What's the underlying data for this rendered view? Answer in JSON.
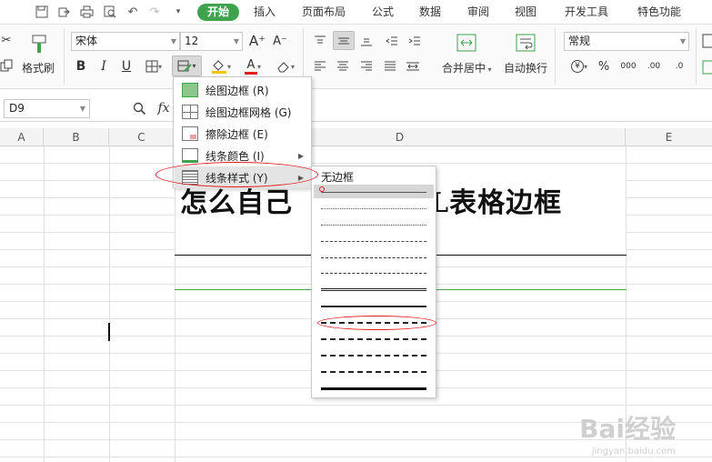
{
  "tabs": [
    "开始",
    "插入",
    "页面布局",
    "公式",
    "数据",
    "审阅",
    "视图",
    "开发工具",
    "特色功能"
  ],
  "ribbon": {
    "format_painter": "格式刷",
    "font_name": "宋体",
    "font_size": "12",
    "merge_center": "合并居中",
    "wrap_text": "自动换行",
    "number_format": "常规",
    "bold": "B",
    "italic": "I",
    "underline": "U",
    "grow_font": "A⁺",
    "shrink_font": "A⁻",
    "font_color_letter": "A",
    "percent": "%",
    "thousands": "000",
    "inc_decimal": ".00",
    "dec_decimal": ".0",
    "accent_green": "#3fa34d"
  },
  "formula_bar": {
    "cell_ref": "D9",
    "fx": "fx"
  },
  "columns": [
    "A",
    "B",
    "C",
    "D",
    "E"
  ],
  "sheet": {
    "title_left": "怎么自己",
    "title_right": "L表格边框"
  },
  "border_menu": {
    "items": [
      {
        "label": "绘图边框 (R)"
      },
      {
        "label": "绘图边框网格 (G)"
      },
      {
        "label": "擦除边框 (E)"
      },
      {
        "label": "线条颜色 (I)"
      },
      {
        "label": "线条样式 (Y)"
      }
    ]
  },
  "line_style_menu": {
    "no_border": "无边框"
  },
  "watermark": {
    "brand": "Bai经验",
    "url": "jingyan.baidu.com"
  },
  "colors": {
    "highlight_ellipse": "#e02020",
    "grid_line": "#e2e2e2"
  }
}
